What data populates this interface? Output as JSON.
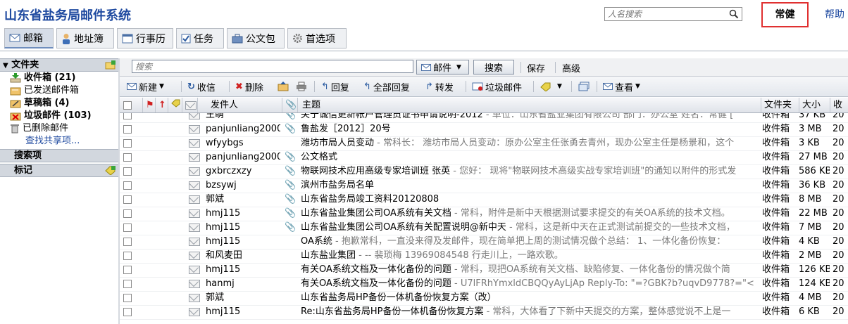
{
  "header": {
    "app_title": "山东省盐务局邮件系统",
    "people_search_placeholder": "人名搜索",
    "user_name": "常健",
    "help_label": "帮助"
  },
  "nav_tabs": [
    {
      "label": "邮箱",
      "icon": "mail-icon",
      "active": true
    },
    {
      "label": "地址簿",
      "icon": "contact-icon"
    },
    {
      "label": "行事历",
      "icon": "calendar-icon"
    },
    {
      "label": "任务",
      "icon": "task-check-icon"
    },
    {
      "label": "公文包",
      "icon": "briefcase-icon"
    },
    {
      "label": "首选项",
      "icon": "gear-icon"
    }
  ],
  "sidebar": {
    "folders_header": "文件夹",
    "folders": [
      {
        "label": "收件箱 (21)",
        "icon": "inbox-icon",
        "bold": true
      },
      {
        "label": "已发送邮件箱",
        "icon": "sent-icon",
        "bold": false
      },
      {
        "label": "草稿箱 (4)",
        "icon": "drafts-icon",
        "bold": true
      },
      {
        "label": "垃圾邮件 (103)",
        "icon": "junk-icon",
        "bold": true
      },
      {
        "label": "已删除邮件",
        "icon": "trash-icon",
        "bold": false
      }
    ],
    "find_shared": "查找共享项...",
    "searches_header": "搜索项",
    "tags_header": "标记"
  },
  "search": {
    "placeholder": "搜索",
    "scope_label": "邮件",
    "search_button": "搜索",
    "save_label": "保存",
    "advanced_label": "高级"
  },
  "toolbar": {
    "new_label": "新建",
    "receive_label": "收信",
    "delete_label": "删除",
    "reply_label": "回复",
    "reply_all_label": "全部回复",
    "forward_label": "转发",
    "junk_label": "垃圾邮件",
    "view_label": "查看"
  },
  "list_header": {
    "sender": "发件人",
    "subject": "主题",
    "folder": "文件夹",
    "size": "大小",
    "received": "收"
  },
  "messages": [
    {
      "sender": "王萌",
      "attach": true,
      "subject": "关于诚信更新帐户管理员证书申请说明-2012",
      "preview": " - 单位：山东省盐业集团有限公司 部门：办公室 姓名：常健 [",
      "folder": "收件箱",
      "size": "37 KB",
      "date": "20"
    },
    {
      "sender": "panjunliang2000",
      "attach": true,
      "subject": "鲁盐发［2012］20号",
      "preview": "",
      "folder": "收件箱",
      "size": "3 MB",
      "date": "20"
    },
    {
      "sender": "wfyybgs",
      "attach": false,
      "subject": "潍坊市局人员变动",
      "preview": " - 常科长：  潍坊市局人员变动：原办公室主任张勇去青州，现办公室主任是杨景和，这个",
      "folder": "收件箱",
      "size": "3 KB",
      "date": "20"
    },
    {
      "sender": "panjunliang2000",
      "attach": true,
      "subject": "公文格式",
      "preview": "",
      "folder": "收件箱",
      "size": "27 MB",
      "date": "20"
    },
    {
      "sender": "gxbrczxzy",
      "attach": true,
      "subject": "物联网技术应用高级专家培训班 张英",
      "preview": " - 您好：  现将\"物联网技术高级实战专家培训班\"的通知以附件的形式发",
      "folder": "收件箱",
      "size": "586 KB",
      "date": "20"
    },
    {
      "sender": "bzsywj",
      "attach": true,
      "subject": "滨州市盐务局名单",
      "preview": "",
      "folder": "收件箱",
      "size": "36 KB",
      "date": "20"
    },
    {
      "sender": "郭斌",
      "attach": true,
      "subject": "山东省盐务局竣工资料20120808",
      "preview": "",
      "folder": "收件箱",
      "size": "8 MB",
      "date": "20"
    },
    {
      "sender": "hmj115",
      "attach": true,
      "subject": "山东省盐业集团公司OA系统有关文档",
      "preview": " - 常科，附件是新中天根据测试要求提交的有关OA系统的技术文档。",
      "folder": "收件箱",
      "size": "22 MB",
      "date": "20"
    },
    {
      "sender": "hmj115",
      "attach": true,
      "subject": "山东省盐业集团公司OA系统有关配置说明@新中天",
      "preview": " - 常科，这是新中天在正式测试前提交的一些技术文档，",
      "folder": "收件箱",
      "size": "7 MB",
      "date": "20"
    },
    {
      "sender": "hmj115",
      "attach": false,
      "subject": "OA系统",
      "preview": " - 抱歉常科，一直没来得及发邮件，现在简单把上周的测试情况做个总结： 1、一体化备份恢复：",
      "folder": "收件箱",
      "size": "4 KB",
      "date": "20"
    },
    {
      "sender": "和风麦田",
      "attach": false,
      "subject": "山东盐业集团",
      "preview": " - -- 裴琐梅 13969084548 行走川上，一路欢歌。",
      "folder": "收件箱",
      "size": "2 MB",
      "date": "20"
    },
    {
      "sender": "hmj115",
      "attach": false,
      "subject": "有关OA系统文档及一体化备份的问题",
      "preview": " - 常科，现把OA系统有关文档、缺陷修复、一体化备份的情况做个简",
      "folder": "收件箱",
      "size": "126 KB",
      "date": "20"
    },
    {
      "sender": "hanmj",
      "attach": false,
      "subject": "有关OA系统文档及一体化备份的问题",
      "preview": " - U7lFRhYmxldCBQQyAyLjAp Reply-To: \"=?GBK?b?uqvD9778?=\"<",
      "folder": "收件箱",
      "size": "124 KB",
      "date": "20"
    },
    {
      "sender": "郭斌",
      "attach": false,
      "subject": "山东省盐务局HP备份一体机备份恢复方案（改）",
      "preview": "",
      "folder": "收件箱",
      "size": "4 MB",
      "date": "20"
    },
    {
      "sender": "hmj115",
      "attach": false,
      "subject": "Re:山东省盐务局HP备份一体机备份恢复方案",
      "preview": " - 常科，大体看了下新中天提交的方案，整体感觉说不上是一",
      "folder": "收件箱",
      "size": "6 KB",
      "date": "20"
    }
  ]
}
